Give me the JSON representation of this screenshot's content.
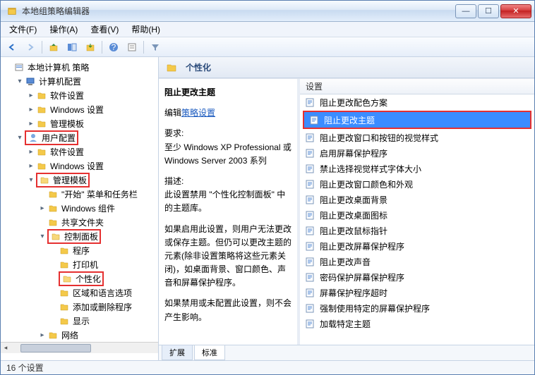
{
  "window": {
    "title": "本地组策略编辑器"
  },
  "menu": {
    "file": "文件(F)",
    "action": "操作(A)",
    "view": "查看(V)",
    "help": "帮助(H)"
  },
  "tree": {
    "root": "本地计算机 策略",
    "computer": "计算机配置",
    "comp_soft": "软件设置",
    "comp_win": "Windows 设置",
    "comp_admin": "管理模板",
    "user": "用户配置",
    "user_soft": "软件设置",
    "user_win": "Windows 设置",
    "user_admin": "管理模板",
    "start_menu": "\"开始\" 菜单和任务栏",
    "win_comp": "Windows 组件",
    "shared": "共享文件夹",
    "ctrl_panel": "控制面板",
    "programs": "程序",
    "printers": "打印机",
    "personal": "个性化",
    "region": "区域和语言选项",
    "addremove": "添加或删除程序",
    "display": "显示",
    "network": "网络"
  },
  "header": {
    "title": "个性化"
  },
  "desc": {
    "title": "阻止更改主题",
    "edit_prefix": "编辑",
    "edit_link": "策略设置",
    "req_label": "要求:",
    "req_text": "至少 Windows XP Professional 或 Windows Server 2003 系列",
    "desc_label": "描述:",
    "desc_text1": "此设置禁用 \"个性化控制面板\" 中的主题库。",
    "desc_text2": "如果启用此设置，则用户无法更改或保存主题。但仍可以更改主题的元素(除非设置策略将这些元素关闭)，如桌面背景、窗口颜色、声音和屏幕保护程序。",
    "desc_text3": "如果禁用或未配置此设置，则不会产生影响。"
  },
  "list": {
    "header": "设置",
    "items": [
      "阻止更改配色方案",
      "阻止更改主题",
      "阻止更改窗口和按钮的视觉样式",
      "启用屏幕保护程序",
      "禁止选择视觉样式字体大小",
      "阻止更改窗口颜色和外观",
      "阻止更改桌面背景",
      "阻止更改桌面图标",
      "阻止更改鼠标指针",
      "阻止更改屏幕保护程序",
      "阻止更改声音",
      "密码保护屏幕保护程序",
      "屏幕保护程序超时",
      "强制使用特定的屏幕保护程序",
      "加载特定主题"
    ]
  },
  "tabs": {
    "extended": "扩展",
    "standard": "标准"
  },
  "status": {
    "text": "16 个设置"
  }
}
